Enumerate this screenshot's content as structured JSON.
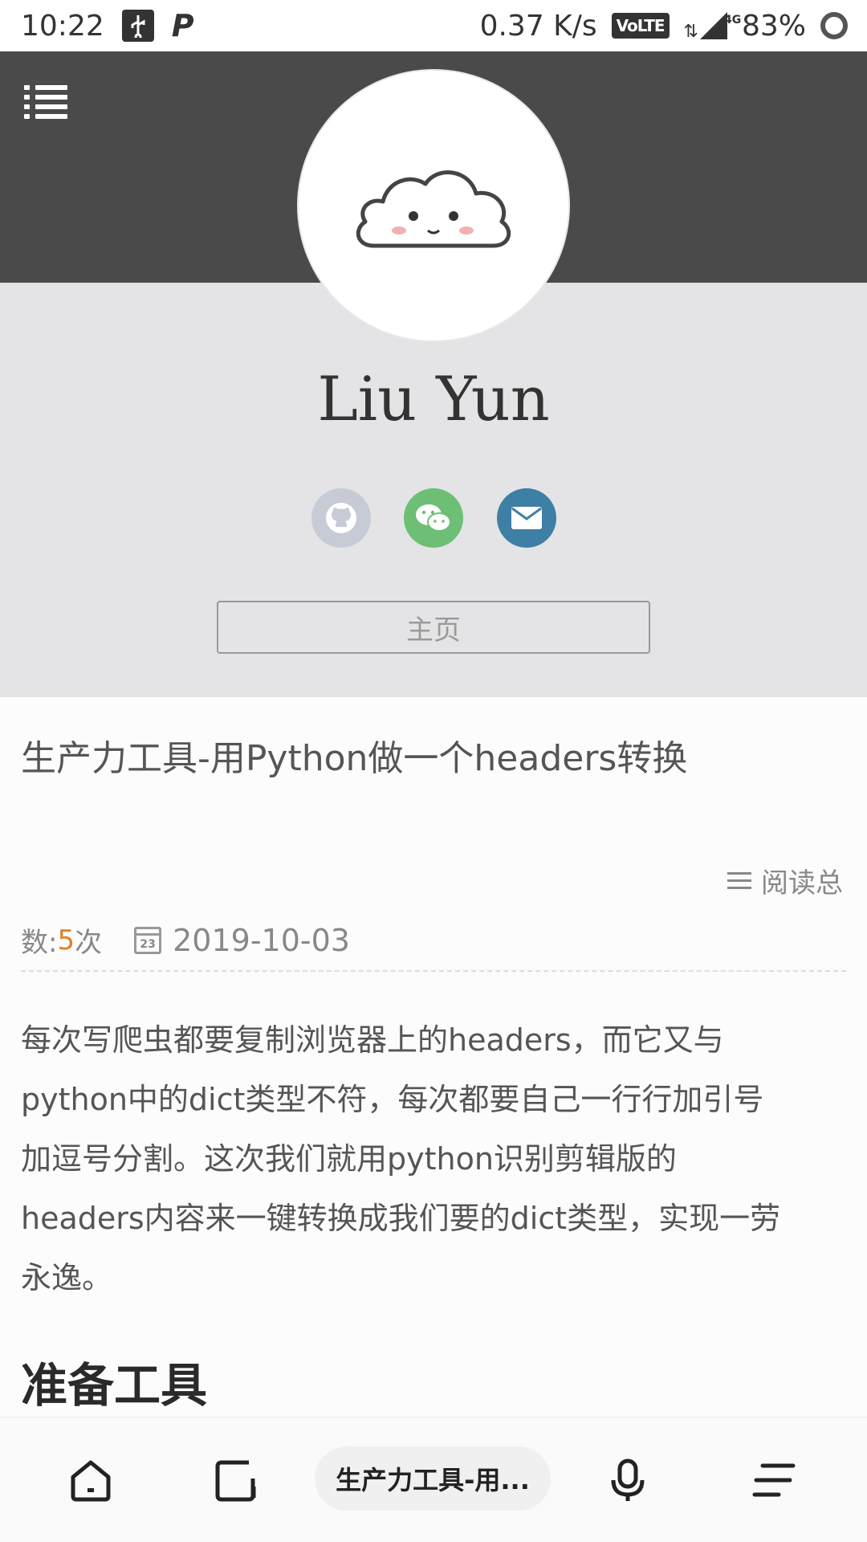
{
  "status_bar": {
    "time": "10:22",
    "network_speed": "0.37 K/s",
    "volte": "VoLTE",
    "network_type": "4G",
    "battery": "83%"
  },
  "header": {
    "menu_icon": "list-menu-icon"
  },
  "profile": {
    "name": "Liu Yun",
    "avatar_icon": "cloud-avatar-icon",
    "social": [
      "github-icon",
      "wechat-icon",
      "mail-icon"
    ],
    "home_button": "主页"
  },
  "article": {
    "title": "生产力工具-用Python做一个headers转换",
    "reads_label_part1": "阅读总",
    "reads_label_part2": "数: ",
    "reads_count": "5",
    "reads_suffix": "次",
    "date": "2019-10-03",
    "calendar_day": "23",
    "body_lines": [
      "每次写爬虫都要复制浏览器上的headers，而它又与",
      "python中的dict类型不符，每次都要自己一行行加引号",
      "加逗号分割。这次我们就用python识别剪辑版的",
      "headers内容来一键转换成我们要的dict类型，实现一劳",
      "永逸。"
    ],
    "section_title": "准备工具"
  },
  "bottom_bar": {
    "url_title": "生产力工具-用..."
  },
  "colors": {
    "header_dark": "#4a4a4a",
    "profile_band": "#e4e4e6",
    "github": "#c7cbd6",
    "wechat": "#6dbf75",
    "mail": "#3e7fa5",
    "accent_count": "#e08020"
  }
}
